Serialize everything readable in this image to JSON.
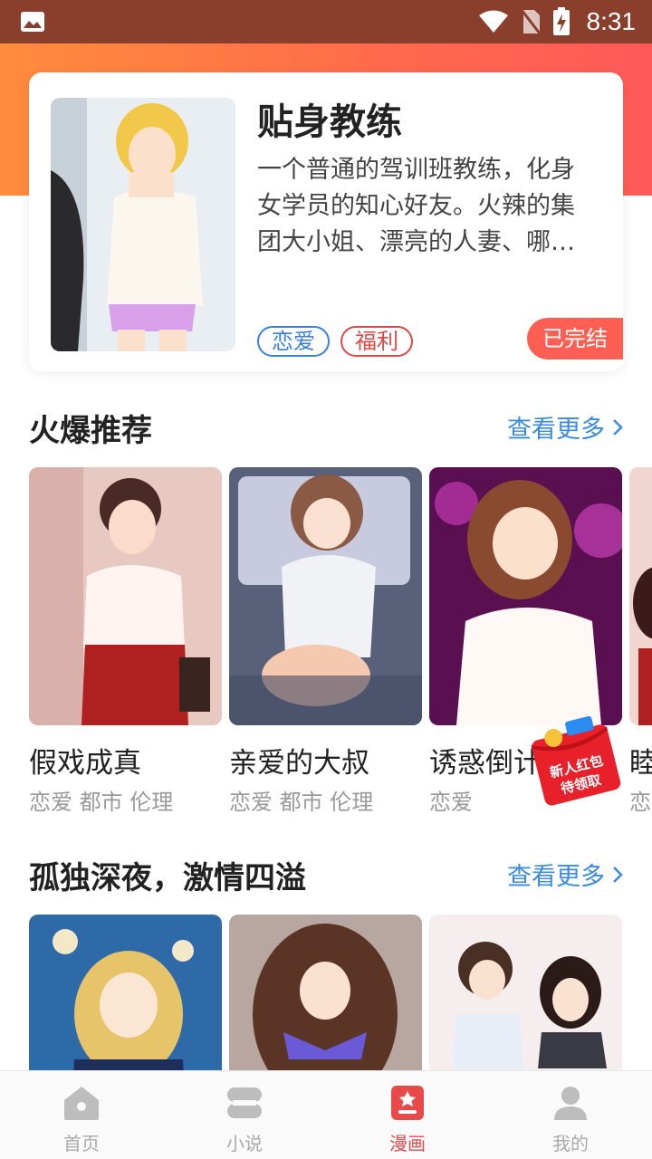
{
  "status_bar": {
    "time": "8:31"
  },
  "featured": {
    "title": "贴身教练",
    "description": "一个普通的驾训班教练，化身女学员的知心好友。火辣的集团大小姐、漂亮的人妻、哪…",
    "tags": [
      "恋爱",
      "福利"
    ],
    "status": "已完结"
  },
  "section_hot": {
    "title": "火爆推荐",
    "more": "查看更多",
    "items": [
      {
        "title": "假戏成真",
        "genres": "恋爱 都市 伦理"
      },
      {
        "title": "亲爱的大叔",
        "genres": "恋爱 都市 伦理"
      },
      {
        "title": "诱惑倒计",
        "genres": "恋爱"
      },
      {
        "title": "睦",
        "genres": "恋"
      }
    ]
  },
  "section_night": {
    "title": "孤独深夜，激情四溢",
    "more": "查看更多"
  },
  "red_packet": {
    "line1": "新人红包",
    "line2": "待领取"
  },
  "tabs": [
    {
      "label": "首页",
      "icon": "home-icon"
    },
    {
      "label": "小说",
      "icon": "book-icon"
    },
    {
      "label": "漫画",
      "icon": "comic-icon"
    },
    {
      "label": "我的",
      "icon": "user-icon"
    }
  ],
  "colors": {
    "accent": "#ff6a4c",
    "link": "#3a8be0",
    "active_tab": "#e84a4a"
  }
}
